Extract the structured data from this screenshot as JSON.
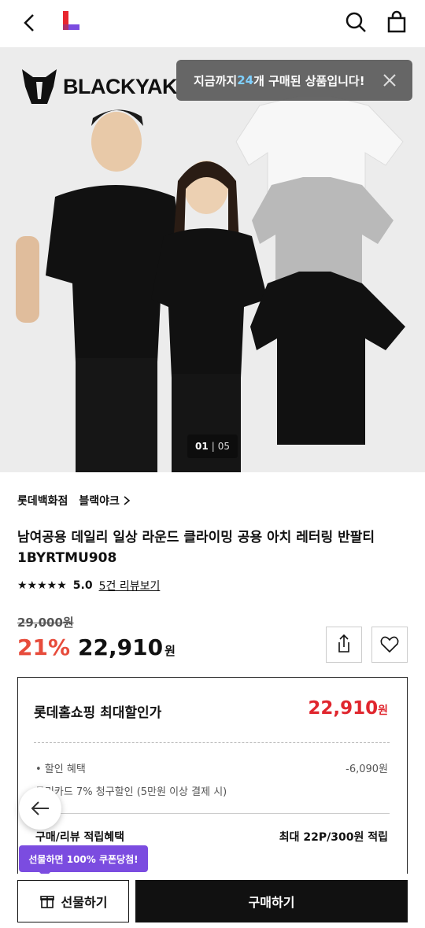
{
  "header": {
    "back_icon": "chevron-left-icon",
    "logo_icon": "lotte-l-logo",
    "search_icon": "search-icon",
    "bag_icon": "shopping-bag-icon"
  },
  "hero": {
    "brand_name": "BLACKYAK",
    "toast_prefix": "지금까지 ",
    "toast_count": "24",
    "toast_suffix": "개 구매된 상품입니다!",
    "page_current": "01",
    "page_total": "05"
  },
  "product": {
    "store": "롯데백화점",
    "brand_link": "블랙야크",
    "title": "남여공용 데일리 일상 라운드 클라이밍 공용 아치 레터링 반팔티 1BYRTMU908",
    "stars": "★★★★★",
    "rating": "5.0",
    "review_link": "5건 리뷰보기",
    "original_price": "29,000원",
    "discount": "21%",
    "price": "22,910",
    "price_unit": "원"
  },
  "benefits": {
    "heading": "롯데홈쇼핑 최대할인가",
    "max_price": "22,910",
    "max_price_unit": "원",
    "discount_label": "• 할인 혜택",
    "discount_value": "-6,090원",
    "card_line": "국민카드 7% 청구할인 (5만원 이상 결제 시)",
    "point_label": "구매/리뷰 적립혜택",
    "point_value": "최대 22P/300원 적립"
  },
  "promo": {
    "label": "선물하면 100% 쿠폰당첨!"
  },
  "bottom": {
    "gift_label": "선물하기",
    "buy_label": "구매하기"
  },
  "colors": {
    "discount_red": "#e74c3c",
    "price_red": "#e0262e",
    "promo_purple": "#7b4ce0",
    "toast_count_blue": "#7fd0ff"
  }
}
